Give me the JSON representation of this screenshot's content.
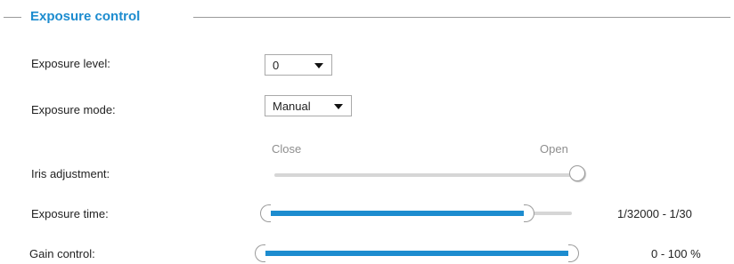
{
  "section": {
    "title": "Exposure control"
  },
  "exposure_level": {
    "label": "Exposure level:",
    "value": "0"
  },
  "exposure_mode": {
    "label": "Exposure mode:",
    "value": "Manual"
  },
  "iris": {
    "label": "Iris adjustment:",
    "min_caption": "Close",
    "max_caption": "Open",
    "level_fraction": 1.0
  },
  "exposure_time": {
    "label": "Exposure time:",
    "range_text": "1/32000 - 1/30",
    "low_fraction": 0.0,
    "high_fraction": 0.86
  },
  "gain": {
    "label": "Gain control:",
    "range_text": "0 - 100 %",
    "low_percent": 0,
    "high_percent": 100
  },
  "colors": {
    "accent": "#1d8ccf",
    "track": "#d6d6d6"
  },
  "icons": {
    "dropdown": "chevron-down-icon"
  }
}
